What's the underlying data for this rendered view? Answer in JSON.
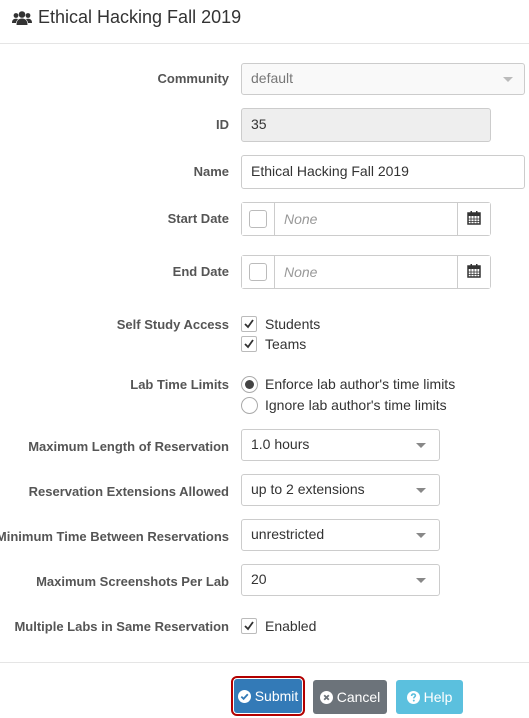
{
  "header": {
    "title": "Ethical Hacking Fall 2019",
    "icon": "users-icon"
  },
  "form": {
    "community": {
      "label": "Community",
      "value": "default"
    },
    "id": {
      "label": "ID",
      "value": "35"
    },
    "name": {
      "label": "Name",
      "value": "Ethical Hacking Fall 2019"
    },
    "start_date": {
      "label": "Start Date",
      "placeholder": "None",
      "checked": false
    },
    "end_date": {
      "label": "End Date",
      "placeholder": "None",
      "checked": false
    },
    "self_study": {
      "label": "Self Study Access",
      "options": [
        {
          "label": "Students",
          "checked": true
        },
        {
          "label": "Teams",
          "checked": true
        }
      ]
    },
    "lab_time_limits": {
      "label": "Lab Time Limits",
      "options": [
        {
          "label": "Enforce lab author's time limits",
          "selected": true
        },
        {
          "label": "Ignore lab author's time limits",
          "selected": false
        }
      ]
    },
    "max_length": {
      "label": "Maximum Length of Reservation",
      "value": "1.0 hours"
    },
    "extensions": {
      "label": "Reservation Extensions Allowed",
      "value": "up to 2 extensions"
    },
    "min_between": {
      "label": "Minimum Time Between Reservations",
      "value": "unrestricted"
    },
    "max_screenshots": {
      "label": "Maximum Screenshots Per Lab",
      "value": "20"
    },
    "multiple_labs": {
      "label": "Multiple Labs in Same Reservation",
      "option": "Enabled",
      "checked": true
    }
  },
  "buttons": {
    "submit": "Submit",
    "cancel": "Cancel",
    "help": "Help"
  },
  "colors": {
    "submit": "#337ab7",
    "submit_outline": "#b20000",
    "cancel": "#6c737a",
    "help": "#5bc0de"
  }
}
